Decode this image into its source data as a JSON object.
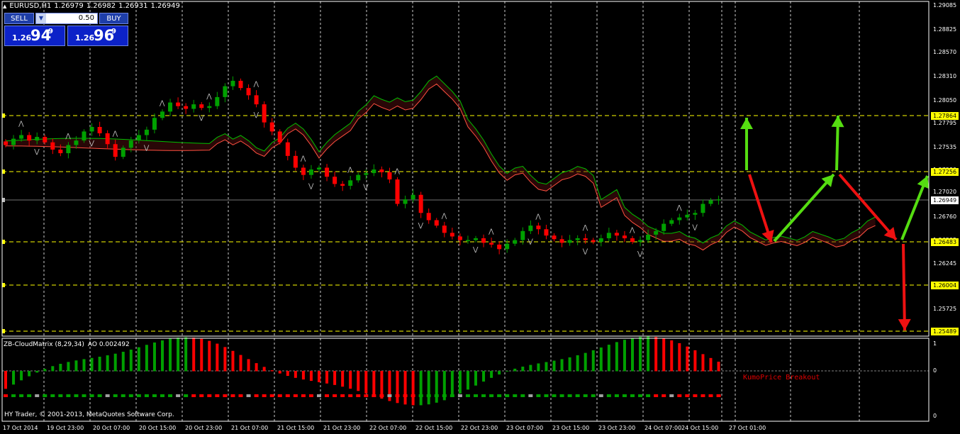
{
  "chart_header": {
    "symbol_timeframe": "EURUSD,H1",
    "ohlc": [
      "1.26979",
      "1.26982",
      "1.26931",
      "1.26949"
    ]
  },
  "trade_panel": {
    "sell_label": "SELL",
    "buy_label": "BUY",
    "lot_value": "0.50",
    "bid": {
      "prefix": "1.26",
      "big": "94",
      "sup": "9"
    },
    "ask": {
      "prefix": "1.26",
      "big": "96",
      "sup": "9"
    }
  },
  "price_axis": {
    "labels": [
      "1.29085",
      "1.28825",
      "1.28570",
      "1.28310",
      "1.28050",
      "1.27795",
      "1.27535",
      "1.27280",
      "1.27020",
      "1.26760",
      "1.26505",
      "1.26245",
      "1.25985",
      "1.25725",
      "1.25470"
    ],
    "marked_levels": [
      {
        "value": "1.27864",
        "color": "#ffff00"
      },
      {
        "value": "1.27256",
        "color": "#ffff00"
      },
      {
        "value": "1.26949",
        "color": "#ffffff"
      },
      {
        "value": "1.26483",
        "color": "#ffff00"
      },
      {
        "value": "1.26004",
        "color": "#ffff00"
      },
      {
        "value": "1.25489",
        "color": "#ffff00"
      }
    ]
  },
  "time_axis": {
    "labels": [
      "17 Oct 2014",
      "19 Oct 23:00",
      "20 Oct 07:00",
      "20 Oct 15:00",
      "20 Oct 23:00",
      "21 Oct 07:00",
      "21 Oct 15:00",
      "21 Oct 23:00",
      "22 Oct 07:00",
      "22 Oct 15:00",
      "22 Oct 23:00",
      "23 Oct 07:00",
      "23 Oct 15:00",
      "23 Oct 23:00",
      "24 Oct 07:00",
      "24 Oct 15:00",
      "27 Oct 01:00"
    ]
  },
  "indicator": {
    "name": "ZB-CloudMatrix (8,29,34)",
    "ao_label": "AO 0.002492",
    "scale": [
      "1",
      "0",
      "0"
    ],
    "annotation": "KumoPrice Breakout"
  },
  "footer": {
    "copyright": "HY Trader, © 2001-2013, MetaQuotes Software Corp."
  },
  "colors": {
    "bull": "#00a000",
    "bear": "#ff0000",
    "kumo_top": "#00c000",
    "kumo_bottom": "#ff5040",
    "level_line": "#ffff00",
    "grid": "#ffffff",
    "arrow_up": "#55dd11",
    "arrow_down": "#ee1111",
    "panel_blue": "#0c22c8"
  },
  "chart_data": {
    "type": "candlestick",
    "symbol": "EURUSD",
    "timeframe": "H1",
    "close_last": 1.26949,
    "ylim": [
      1.2547,
      1.2909
    ],
    "levels": [
      1.27864,
      1.27256,
      1.26483,
      1.26004,
      1.25489
    ],
    "close_series": [
      1.2755,
      1.2762,
      1.2766,
      1.276,
      1.2764,
      1.2758,
      1.275,
      1.2746,
      1.2755,
      1.276,
      1.277,
      1.2775,
      1.2768,
      1.2756,
      1.2742,
      1.2752,
      1.276,
      1.2766,
      1.2772,
      1.2785,
      1.2792,
      1.2802,
      1.2798,
      1.2795,
      1.28,
      1.2796,
      1.2798,
      1.2808,
      1.282,
      1.2826,
      1.2818,
      1.281,
      1.28,
      1.278,
      1.277,
      1.2758,
      1.2743,
      1.273,
      1.2722,
      1.2728,
      1.273,
      1.272,
      1.2712,
      1.271,
      1.2716,
      1.2722,
      1.2724,
      1.2728,
      1.2725,
      1.2717,
      1.269,
      1.2695,
      1.27,
      1.268,
      1.2672,
      1.2666,
      1.2658,
      1.2654,
      1.265,
      1.265,
      1.2652,
      1.2647,
      1.2645,
      1.264,
      1.2646,
      1.265,
      1.266,
      1.2666,
      1.2662,
      1.2655,
      1.2651,
      1.2647,
      1.265,
      1.2652,
      1.265,
      1.2648,
      1.2652,
      1.2658,
      1.2655,
      1.2652,
      1.2648,
      1.265,
      1.2656,
      1.266,
      1.2668,
      1.2672,
      1.2675,
      1.2678,
      1.268,
      1.269,
      1.2694,
      1.2695
    ]
  }
}
